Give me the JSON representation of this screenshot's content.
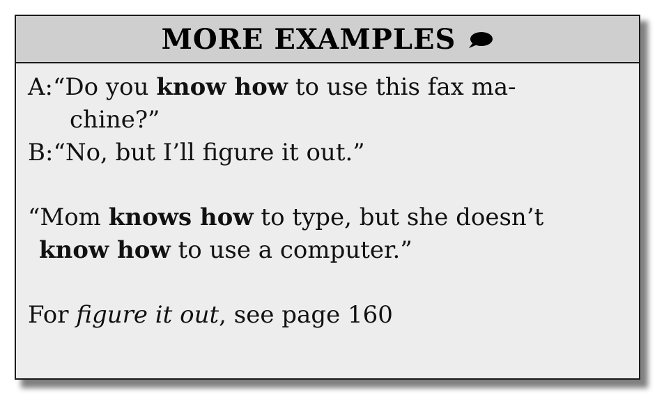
{
  "title": "MORE EXAMPLES",
  "icon": "speech-bubble-icon",
  "dialogue": {
    "a_speaker": "A:",
    "a_open": "“Do you ",
    "a_bold": "know how",
    "a_rest": " to use this fax ma-",
    "a_cont": "chine?”",
    "b_speaker": "B:",
    "b_text": "“No, but I’ll figure it out.”"
  },
  "example2": {
    "open": "“Mom ",
    "bold1": "knows how",
    "mid": " to type, but she doesn’t",
    "bold2": "know how",
    "end": " to use a computer.”"
  },
  "reference": {
    "prefix": "For ",
    "italic": "figure it out",
    "suffix": ", see page 160"
  }
}
